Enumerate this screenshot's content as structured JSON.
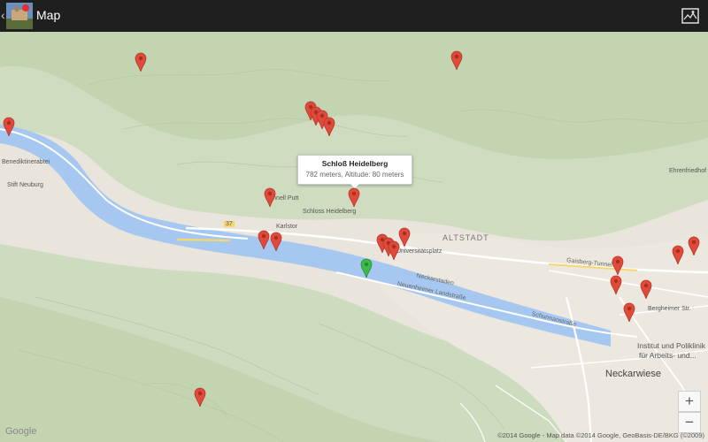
{
  "actionbar": {
    "back_glyph": "‹",
    "title": "Map",
    "app_icon": "app-icon",
    "mode_icon": "map-type-icon"
  },
  "map": {
    "colors": {
      "land": "#e9e5dc",
      "terrain": "#c9d8b9",
      "river": "#a6c8f0",
      "road": "#ffffff",
      "marker_red": "#e04a3a",
      "marker_green": "#3dbb4a"
    },
    "labels": {
      "stift": "Stift Neuburg",
      "benedikt": "Benediktinerabtei",
      "schloss": "Schloss Heidelberg",
      "karlstor": "Karlstor",
      "schnell": "Schnell Putt",
      "altstadt": "ALTSTADT",
      "uniplatz": "Universitätsplatz",
      "neckarstaden": "Neckarstaden",
      "neuenheimer": "Neuenheimer Landstraße",
      "schurman": "Schurmanstraße",
      "gaisberg": "Gaisberg-Tunnel",
      "bergheimer": "Bergheimer Str.",
      "institut1": "Institut und Poliklinik",
      "institut2": "für Arbeits- und...",
      "neckarwiese": "Neckarwiese",
      "ehrenfriedhof": "Ehrenfriedhof",
      "road_37": "37"
    },
    "infowindow": {
      "title": "Schloß Heidelberg",
      "subtitle": "782 meters, Altitude: 80 meters"
    },
    "zoom": {
      "in": "+",
      "out": "−"
    },
    "google": "Google",
    "copyright": "©2014 Google - Map data ©2014 Google, GeoBasis-DE/BKG (©2009)"
  }
}
